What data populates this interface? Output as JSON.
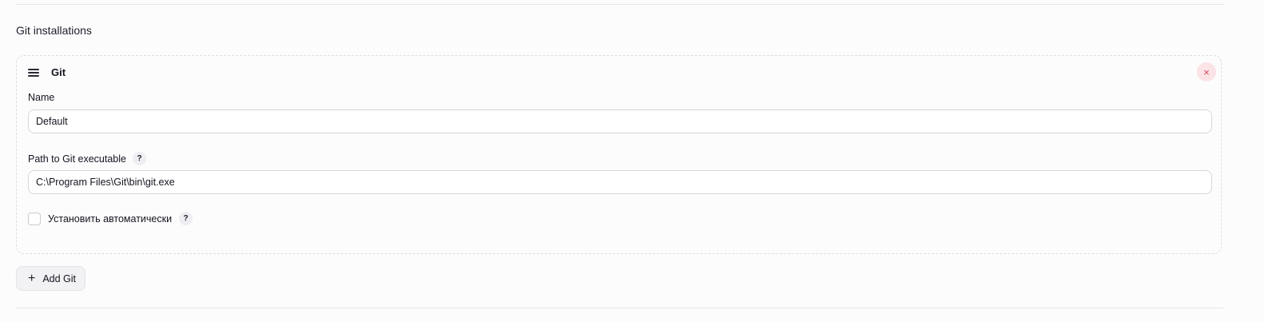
{
  "section": {
    "title": "Git installations"
  },
  "installation": {
    "title": "Git",
    "delete_icon": "×",
    "name_label": "Name",
    "name_value": "Default",
    "path_label": "Path to Git executable",
    "path_value": "C:\\Program Files\\Git\\bin\\git.exe",
    "help_icon": "?",
    "auto_install_label": "Установить автоматически",
    "auto_install_checked": false
  },
  "actions": {
    "add_icon": "+",
    "add_label": "Add Git"
  },
  "colors": {
    "delete_bg": "#fbe3e6",
    "delete_fg": "#d6455a"
  }
}
